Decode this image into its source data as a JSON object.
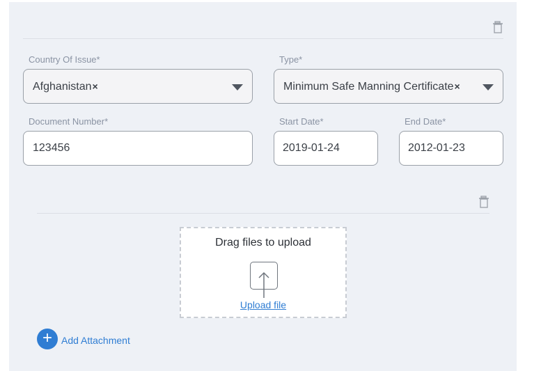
{
  "icons": {
    "delete": "trash-icon",
    "upload": "upload-icon",
    "add": "plus-icon",
    "dropdown": "chevron-down-icon"
  },
  "colors": {
    "accent": "#2f7dd3",
    "panel_bg": "#eef1f6",
    "label": "#8a93a3"
  },
  "form": {
    "country": {
      "label": "Country Of Issue*",
      "value": "Afghanistan",
      "clear": "×"
    },
    "type": {
      "label": "Type*",
      "value": "Minimum Safe Manning Certificate",
      "clear": "×"
    },
    "document_number": {
      "label": "Document Number*",
      "value": "123456"
    },
    "start_date": {
      "label": "Start Date*",
      "value": "2019-01-24"
    },
    "end_date": {
      "label": "End Date*",
      "value": "2012-01-23"
    }
  },
  "attachment": {
    "drop_text": "Drag files to upload",
    "upload_link": "Upload file",
    "add_symbol": "+",
    "add_label": "Add Attachment"
  }
}
